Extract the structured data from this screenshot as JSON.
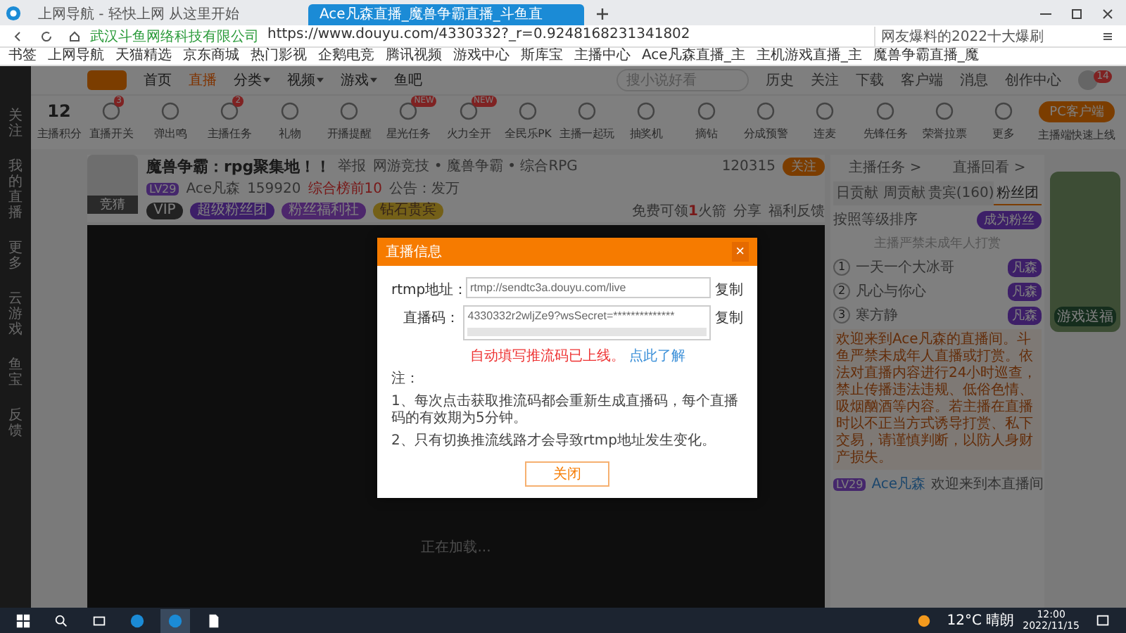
{
  "browser": {
    "tabs": [
      {
        "label": "上网导航 - 轻快上网 从这里开始",
        "selected": false
      },
      {
        "label": "Ace凡森直播_魔兽争霸直播_斗鱼直",
        "selected": true
      }
    ],
    "site_name": "武汉斗鱼网络科技有限公司",
    "url": "https://www.douyu.com/4330332?_r=0.9248168231341802",
    "search_hint": "网友爆料的2022十大爆刷",
    "bookmarks": [
      "书签",
      "上网导航",
      "天猫精选",
      "京东商城",
      "热门影视",
      "企鹅电竞",
      "腾讯视频",
      "游戏中心",
      "斯库宝",
      "主播中心",
      "Ace凡森直播_主",
      "主机游戏直播_主",
      "魔兽争霸直播_魔"
    ]
  },
  "site": {
    "nav": [
      {
        "label": "首页",
        "selected": false,
        "dropdown": false
      },
      {
        "label": "直播",
        "selected": true,
        "dropdown": false
      },
      {
        "label": "分类",
        "selected": false,
        "dropdown": true
      },
      {
        "label": "视频",
        "selected": false,
        "dropdown": true
      },
      {
        "label": "游戏",
        "selected": false,
        "dropdown": true
      },
      {
        "label": "鱼吧",
        "selected": false,
        "dropdown": false
      }
    ],
    "search_placeholder": "搜小说好看",
    "links": [
      "历史",
      "关注",
      "下载",
      "客户端",
      "消息",
      "创作中心"
    ],
    "avatar_badge": "14",
    "side_items": [
      "关注",
      "我的直播",
      "更多",
      "云游戏",
      "鱼宝",
      "反馈"
    ]
  },
  "toolbar": {
    "score": "12",
    "score_label": "主播积分",
    "items": [
      {
        "label": "直播开关",
        "badge": "3"
      },
      {
        "label": "弹出鸣"
      },
      {
        "label": "主播任务",
        "badge": "2"
      },
      {
        "label": "礼物"
      },
      {
        "label": "开播提醒"
      },
      {
        "label": "星光任务",
        "badge": "NEW"
      },
      {
        "label": "火力全开",
        "badge": "NEW"
      },
      {
        "label": "全民乐PK"
      },
      {
        "label": "主播一起玩"
      },
      {
        "label": "抽奖机"
      },
      {
        "label": "摘钻"
      },
      {
        "label": "分成预警"
      },
      {
        "label": "连麦"
      },
      {
        "label": "先锋任务"
      },
      {
        "label": "荣誉拉票"
      },
      {
        "label": "更多"
      }
    ],
    "pc_button": "PC客户端",
    "pc_caption": "主播端快速上线"
  },
  "room": {
    "title": "魔兽争霸：rpg聚集地！！",
    "report": "举报",
    "category": "网游竞技 • 魔兽争霸 • 综合RPG",
    "level": "LV29",
    "streamer": "Ace凡森",
    "heat": "159920",
    "rank": "综合榜前10",
    "notice": "公告：发万",
    "avatar_caption": "竞猜",
    "badges": [
      "VIP",
      "超级粉丝团",
      "粉丝福利社",
      "钻石贵宾"
    ],
    "followers": "120315",
    "follow": "关注",
    "rocket_prefix": "免费可领",
    "rocket_count": "1",
    "rocket_suffix": "火箭",
    "share": "分享",
    "feedback": "福利反馈"
  },
  "video": {
    "loading": "正在加载..."
  },
  "modal": {
    "title": "直播信息",
    "close": "×",
    "fields": [
      {
        "kind": "input",
        "label": "rtmp地址：",
        "value": "rtmp://sendtc3a.douyu.com/live",
        "action": "复制"
      },
      {
        "kind": "textarea",
        "label": "直播码：",
        "value": "4330332r2wljZe9?wsSecret=**************",
        "action": "复制"
      }
    ],
    "notice": "自动填写推流码已上线。",
    "notice_link": "点此了解",
    "notes_title": "注：",
    "notes": [
      "1、每次点击获取推流码都会重新生成直播码，每个直播码的有效期为5分钟。",
      "2、只有切换推流线路才会导致rtmp地址发生变化。"
    ],
    "button": "关闭"
  },
  "panel": {
    "links": [
      "主播任务 >",
      "直播回看 >"
    ],
    "tabs": [
      {
        "label": "日贡献",
        "selected": false
      },
      {
        "label": "周贡献",
        "selected": false
      },
      {
        "label": "贵宾(160)",
        "selected": false
      },
      {
        "label": "粉丝团",
        "selected": true
      }
    ],
    "rank_title": "按照等级排序",
    "join": "成为粉丝",
    "rank_hint": "主播严禁未成年人打赏",
    "ranks": [
      {
        "no": "1",
        "name": "一天一个大冰哥",
        "tag": "凡森"
      },
      {
        "no": "2",
        "name": "凡心与你心",
        "tag": "凡森"
      },
      {
        "no": "3",
        "name": "寒方静",
        "tag": "凡森"
      }
    ],
    "welcome": "欢迎来到Ace凡森的直播间。斗鱼严禁未成年人直播或打赏。依法对直播内容进行24小时巡查，禁止传播违法违规、低俗色情、吸烟酗酒等内容。若主播在直播时以不正当方式诱导打赏、私下交易，请谨慎判断，以防人身财产损失。",
    "chat_level": "LV29",
    "chat_user": "Ace凡森",
    "chat_text": "欢迎来到本直播间",
    "ad": "游戏送福"
  },
  "taskbar": {
    "weather": "12°C 晴朗",
    "time": "12:00",
    "date": "2022/11/15"
  }
}
